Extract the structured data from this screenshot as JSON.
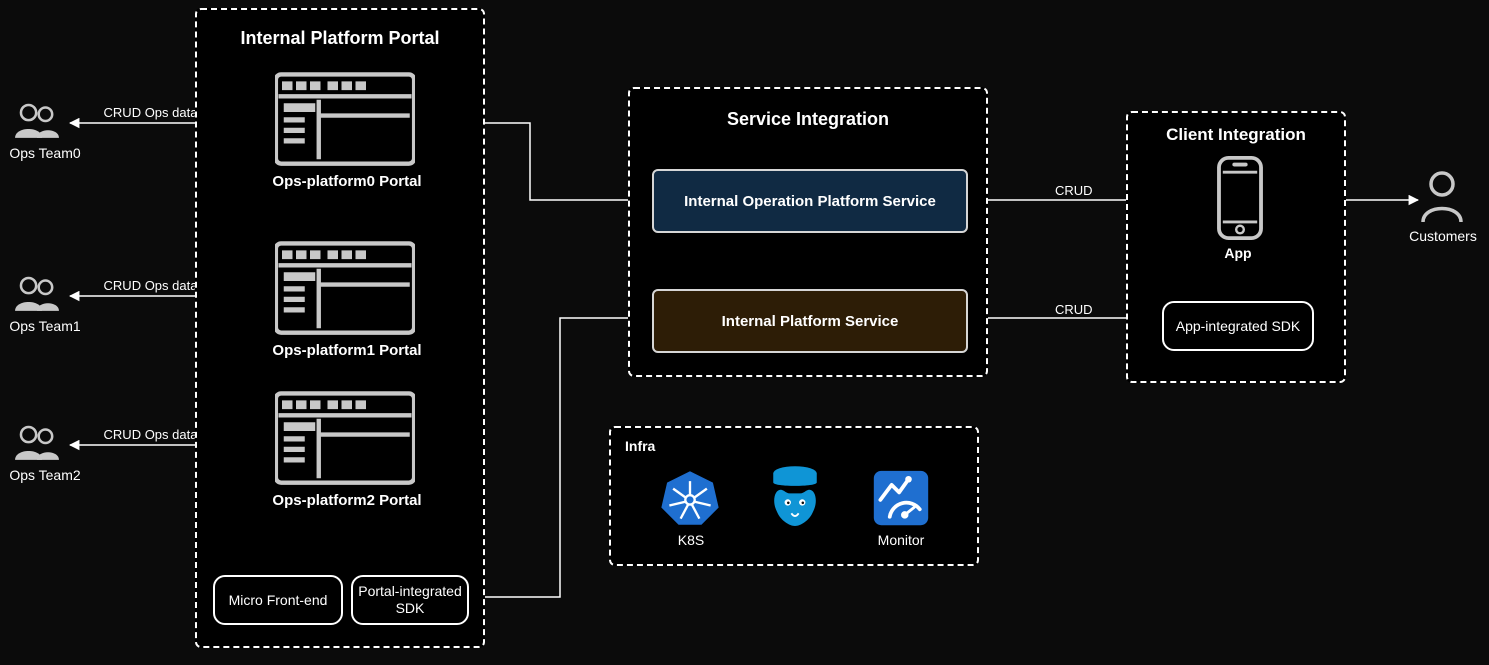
{
  "portal": {
    "title": "Internal Platform Portal",
    "items": [
      {
        "label": "Ops-platform0 Portal"
      },
      {
        "label": "Ops-platform1 Portal"
      },
      {
        "label": "Ops-platform2 Portal"
      }
    ],
    "micro_frontend": "Micro Front-end",
    "portal_sdk": "Portal-integrated SDK"
  },
  "ops_teams": [
    {
      "name": "Ops Team0",
      "edge_label": "CRUD Ops data"
    },
    {
      "name": "Ops Team1",
      "edge_label": "CRUD Ops data"
    },
    {
      "name": "Ops Team2",
      "edge_label": "CRUD Ops data"
    }
  ],
  "service_integration": {
    "title": "Service Integration",
    "internal_op_service": "Internal Operation Platform Service",
    "internal_platform_service": "Internal Platform Service"
  },
  "client_integration": {
    "title": "Client Integration",
    "app_label": "App",
    "sdk_label": "App-integrated SDK"
  },
  "customers": {
    "label": "Customers"
  },
  "edges": {
    "crud_top": "CRUD",
    "crud_bottom": "CRUD"
  },
  "infra": {
    "title": "Infra",
    "items": {
      "k8s": "K8S",
      "postgres": "",
      "monitor": "Monitor"
    }
  }
}
